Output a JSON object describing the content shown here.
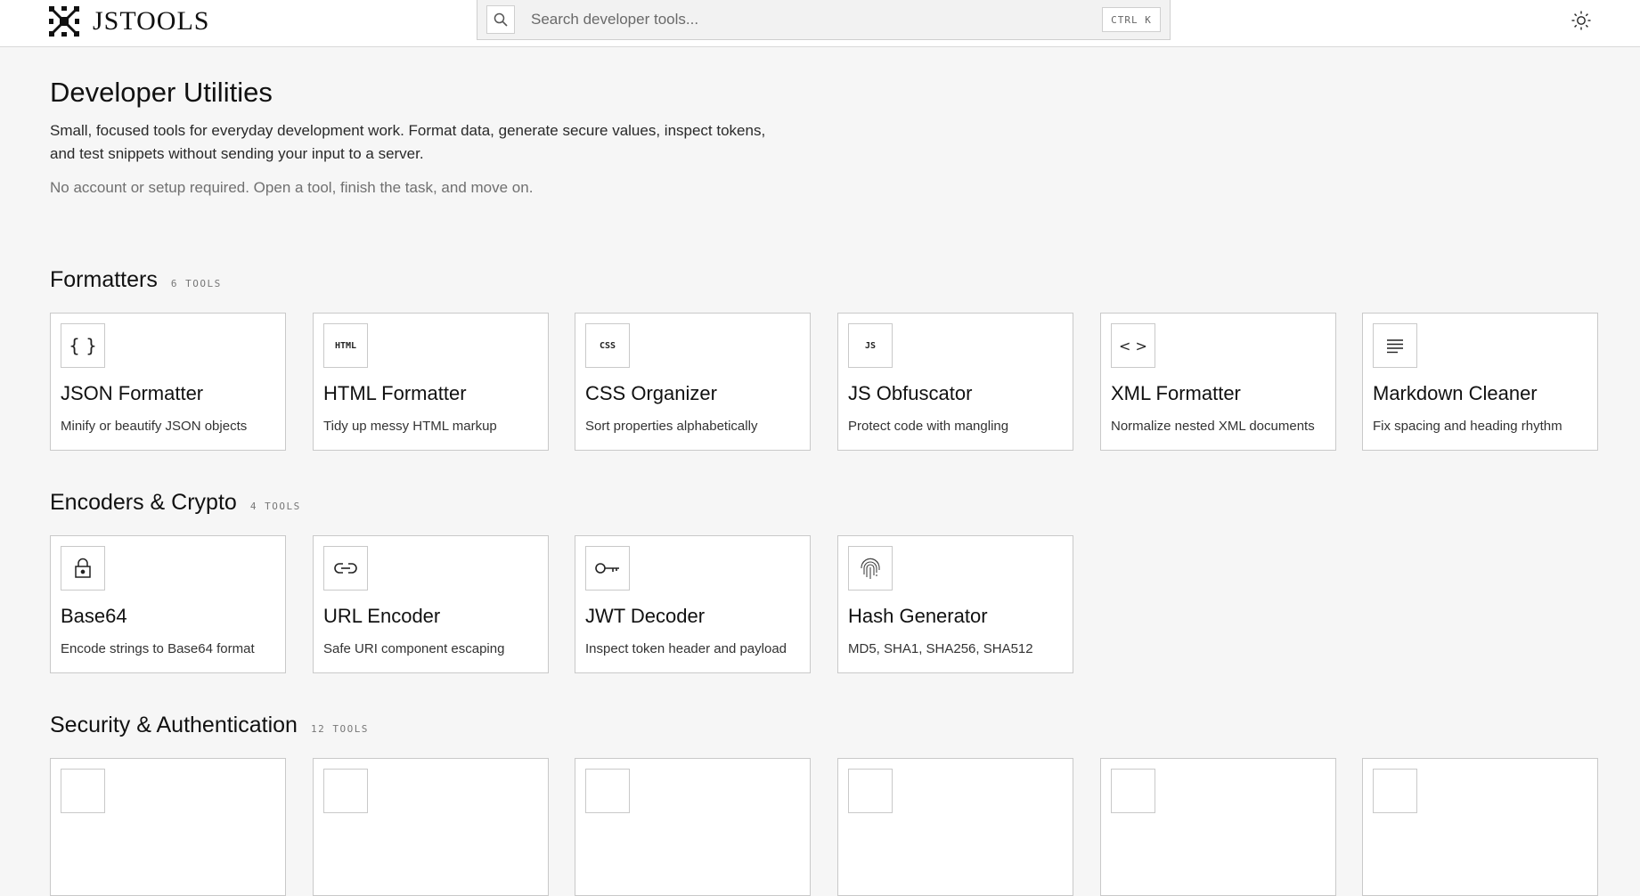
{
  "header": {
    "logo_text": "JSTOOLS",
    "search_placeholder": "Search developer tools...",
    "shortcut": "CTRL K",
    "theme_icon": "sun-icon"
  },
  "intro": {
    "title": "Developer Utilities",
    "description": "Small, focused tools for everyday development work. Format data, generate secure values, inspect tokens, and test snippets without sending your input to a server.",
    "note": "No account or setup required. Open a tool, finish the task, and move on."
  },
  "sections": [
    {
      "title": "Formatters",
      "count": "6 TOOLS",
      "tools": [
        {
          "icon": "braces-icon",
          "icon_text": "{ }",
          "title": "JSON Formatter",
          "desc": "Minify or beautify JSON objects"
        },
        {
          "icon": "html-icon",
          "icon_text": "HTML",
          "title": "HTML Formatter",
          "desc": "Tidy up messy HTML markup"
        },
        {
          "icon": "css-icon",
          "icon_text": "CSS",
          "title": "CSS Organizer",
          "desc": "Sort properties alphabetically"
        },
        {
          "icon": "js-icon",
          "icon_text": "JS",
          "title": "JS Obfuscator",
          "desc": "Protect code with mangling"
        },
        {
          "icon": "code-brackets-icon",
          "icon_text": "< >",
          "title": "XML Formatter",
          "desc": "Normalize nested XML documents"
        },
        {
          "icon": "text-lines-icon",
          "icon_text": "",
          "title": "Markdown Cleaner",
          "desc": "Fix spacing and heading rhythm"
        }
      ]
    },
    {
      "title": "Encoders & Crypto",
      "count": "4 TOOLS",
      "tools": [
        {
          "icon": "lock-icon",
          "icon_text": "",
          "title": "Base64",
          "desc": "Encode strings to Base64 format"
        },
        {
          "icon": "link-icon",
          "icon_text": "",
          "title": "URL Encoder",
          "desc": "Safe URI component escaping"
        },
        {
          "icon": "key-icon",
          "icon_text": "",
          "title": "JWT Decoder",
          "desc": "Inspect token header and payload"
        },
        {
          "icon": "fingerprint-icon",
          "icon_text": "",
          "title": "Hash Generator",
          "desc": "MD5, SHA1, SHA256, SHA512"
        }
      ]
    },
    {
      "title": "Security & Authentication",
      "count": "12 TOOLS"
    }
  ]
}
